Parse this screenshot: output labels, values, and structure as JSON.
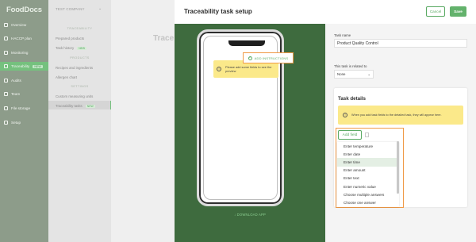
{
  "app": {
    "logo": "FoodDocs"
  },
  "sidebar": {
    "items": [
      {
        "label": "Overview",
        "icon": "home-icon"
      },
      {
        "label": "HACCP plan",
        "icon": "book-icon"
      },
      {
        "label": "Monitoring",
        "icon": "chart-icon"
      },
      {
        "label": "Traceability",
        "icon": "trace-icon",
        "badge": "NEW"
      },
      {
        "label": "Audits",
        "icon": "audit-icon"
      },
      {
        "label": "Team",
        "icon": "team-icon"
      },
      {
        "label": "File storage",
        "icon": "folder-icon"
      },
      {
        "label": "Setup",
        "icon": "gear-icon"
      }
    ]
  },
  "subnav": {
    "company": "TEST COMPANY",
    "section_traceability": "TRACEABILITY",
    "prepared_products": "Prepared products",
    "task_history": "Task history",
    "task_history_badge": "NEW",
    "section_products": "PRODUCTS",
    "recipes": "Recipes and ingredients",
    "allergen_chart": "Allergen chart",
    "section_settings": "SETTINGS",
    "custom_units": "Custom measuring units",
    "traceability_tasks": "Traceability tasks",
    "traceability_tasks_badge": "NEW"
  },
  "background": {
    "title": "Trace"
  },
  "modal": {
    "title": "Traceability task setup",
    "cancel": "Cancel",
    "save": "Save",
    "preview_alert": "Please add some fields to see the preview",
    "download_app": "↓ DOWNLOAD APP",
    "task_name_label": "Task name",
    "task_name_value": "Product Quality Control",
    "add_instructions": "ADD INSTRUCTIONS",
    "related_label": "This task is related to",
    "related_value": "None",
    "task_details_title": "Task details",
    "task_details_alert": "When you add task fields to the detailed task, they will appear here.",
    "add_field": "Add field",
    "field_options": [
      "Enter temperature",
      "Enter date",
      "Enter time",
      "Enter amount",
      "Enter text",
      "Enter numeric value",
      "Choose multiple answers",
      "Choose one answer"
    ],
    "highlighted_option": "Enter time"
  },
  "colors": {
    "brand_green": "#63b26c",
    "sidebar": "#8d9c8a",
    "preview_bg": "#3e6b3e",
    "highlight_orange": "#f09a46",
    "alert_yellow": "#fbe98a"
  }
}
